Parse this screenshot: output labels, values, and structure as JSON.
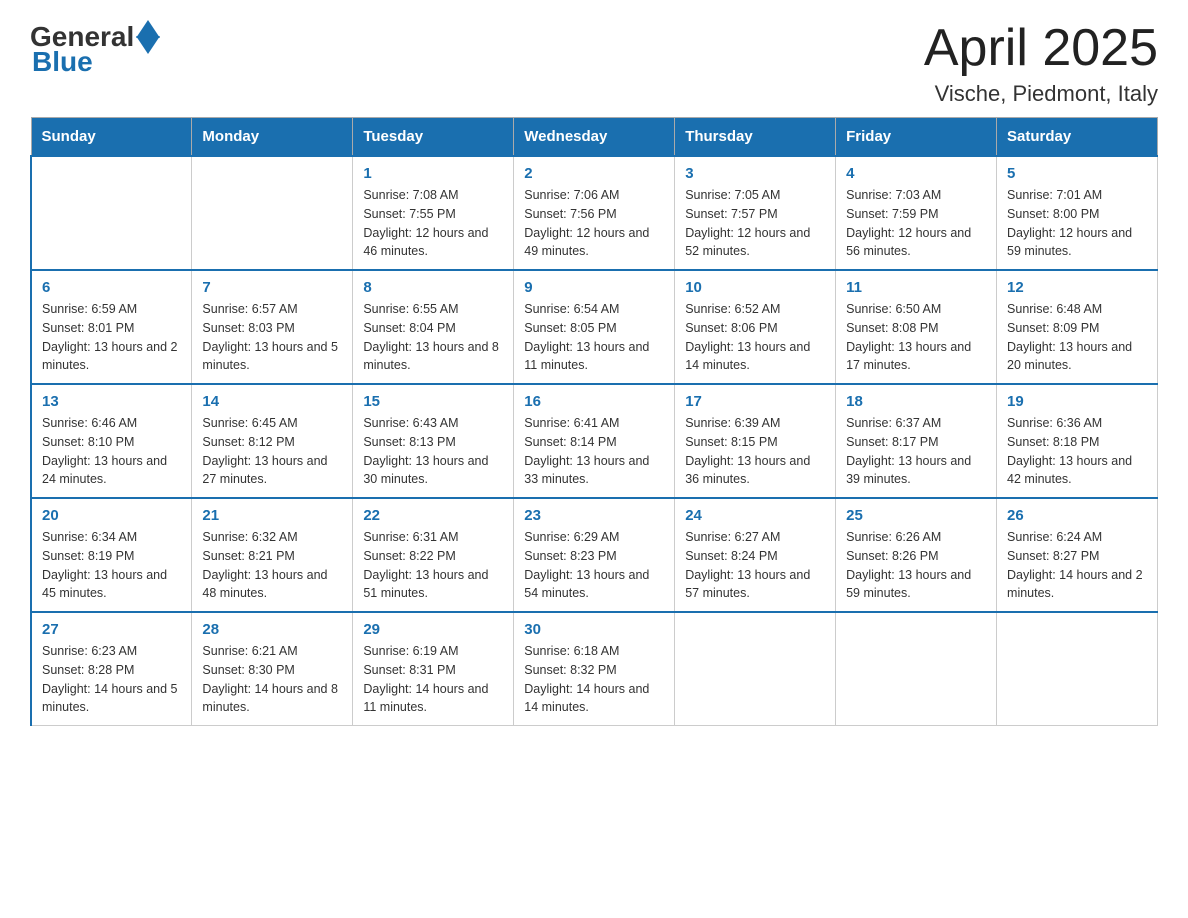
{
  "header": {
    "logo_general": "General",
    "logo_blue": "Blue",
    "month_title": "April 2025",
    "location": "Vische, Piedmont, Italy"
  },
  "days_of_week": [
    "Sunday",
    "Monday",
    "Tuesday",
    "Wednesday",
    "Thursday",
    "Friday",
    "Saturday"
  ],
  "weeks": [
    [
      {
        "day": "",
        "sunrise": "",
        "sunset": "",
        "daylight": ""
      },
      {
        "day": "",
        "sunrise": "",
        "sunset": "",
        "daylight": ""
      },
      {
        "day": "1",
        "sunrise": "Sunrise: 7:08 AM",
        "sunset": "Sunset: 7:55 PM",
        "daylight": "Daylight: 12 hours and 46 minutes."
      },
      {
        "day": "2",
        "sunrise": "Sunrise: 7:06 AM",
        "sunset": "Sunset: 7:56 PM",
        "daylight": "Daylight: 12 hours and 49 minutes."
      },
      {
        "day": "3",
        "sunrise": "Sunrise: 7:05 AM",
        "sunset": "Sunset: 7:57 PM",
        "daylight": "Daylight: 12 hours and 52 minutes."
      },
      {
        "day": "4",
        "sunrise": "Sunrise: 7:03 AM",
        "sunset": "Sunset: 7:59 PM",
        "daylight": "Daylight: 12 hours and 56 minutes."
      },
      {
        "day": "5",
        "sunrise": "Sunrise: 7:01 AM",
        "sunset": "Sunset: 8:00 PM",
        "daylight": "Daylight: 12 hours and 59 minutes."
      }
    ],
    [
      {
        "day": "6",
        "sunrise": "Sunrise: 6:59 AM",
        "sunset": "Sunset: 8:01 PM",
        "daylight": "Daylight: 13 hours and 2 minutes."
      },
      {
        "day": "7",
        "sunrise": "Sunrise: 6:57 AM",
        "sunset": "Sunset: 8:03 PM",
        "daylight": "Daylight: 13 hours and 5 minutes."
      },
      {
        "day": "8",
        "sunrise": "Sunrise: 6:55 AM",
        "sunset": "Sunset: 8:04 PM",
        "daylight": "Daylight: 13 hours and 8 minutes."
      },
      {
        "day": "9",
        "sunrise": "Sunrise: 6:54 AM",
        "sunset": "Sunset: 8:05 PM",
        "daylight": "Daylight: 13 hours and 11 minutes."
      },
      {
        "day": "10",
        "sunrise": "Sunrise: 6:52 AM",
        "sunset": "Sunset: 8:06 PM",
        "daylight": "Daylight: 13 hours and 14 minutes."
      },
      {
        "day": "11",
        "sunrise": "Sunrise: 6:50 AM",
        "sunset": "Sunset: 8:08 PM",
        "daylight": "Daylight: 13 hours and 17 minutes."
      },
      {
        "day": "12",
        "sunrise": "Sunrise: 6:48 AM",
        "sunset": "Sunset: 8:09 PM",
        "daylight": "Daylight: 13 hours and 20 minutes."
      }
    ],
    [
      {
        "day": "13",
        "sunrise": "Sunrise: 6:46 AM",
        "sunset": "Sunset: 8:10 PM",
        "daylight": "Daylight: 13 hours and 24 minutes."
      },
      {
        "day": "14",
        "sunrise": "Sunrise: 6:45 AM",
        "sunset": "Sunset: 8:12 PM",
        "daylight": "Daylight: 13 hours and 27 minutes."
      },
      {
        "day": "15",
        "sunrise": "Sunrise: 6:43 AM",
        "sunset": "Sunset: 8:13 PM",
        "daylight": "Daylight: 13 hours and 30 minutes."
      },
      {
        "day": "16",
        "sunrise": "Sunrise: 6:41 AM",
        "sunset": "Sunset: 8:14 PM",
        "daylight": "Daylight: 13 hours and 33 minutes."
      },
      {
        "day": "17",
        "sunrise": "Sunrise: 6:39 AM",
        "sunset": "Sunset: 8:15 PM",
        "daylight": "Daylight: 13 hours and 36 minutes."
      },
      {
        "day": "18",
        "sunrise": "Sunrise: 6:37 AM",
        "sunset": "Sunset: 8:17 PM",
        "daylight": "Daylight: 13 hours and 39 minutes."
      },
      {
        "day": "19",
        "sunrise": "Sunrise: 6:36 AM",
        "sunset": "Sunset: 8:18 PM",
        "daylight": "Daylight: 13 hours and 42 minutes."
      }
    ],
    [
      {
        "day": "20",
        "sunrise": "Sunrise: 6:34 AM",
        "sunset": "Sunset: 8:19 PM",
        "daylight": "Daylight: 13 hours and 45 minutes."
      },
      {
        "day": "21",
        "sunrise": "Sunrise: 6:32 AM",
        "sunset": "Sunset: 8:21 PM",
        "daylight": "Daylight: 13 hours and 48 minutes."
      },
      {
        "day": "22",
        "sunrise": "Sunrise: 6:31 AM",
        "sunset": "Sunset: 8:22 PM",
        "daylight": "Daylight: 13 hours and 51 minutes."
      },
      {
        "day": "23",
        "sunrise": "Sunrise: 6:29 AM",
        "sunset": "Sunset: 8:23 PM",
        "daylight": "Daylight: 13 hours and 54 minutes."
      },
      {
        "day": "24",
        "sunrise": "Sunrise: 6:27 AM",
        "sunset": "Sunset: 8:24 PM",
        "daylight": "Daylight: 13 hours and 57 minutes."
      },
      {
        "day": "25",
        "sunrise": "Sunrise: 6:26 AM",
        "sunset": "Sunset: 8:26 PM",
        "daylight": "Daylight: 13 hours and 59 minutes."
      },
      {
        "day": "26",
        "sunrise": "Sunrise: 6:24 AM",
        "sunset": "Sunset: 8:27 PM",
        "daylight": "Daylight: 14 hours and 2 minutes."
      }
    ],
    [
      {
        "day": "27",
        "sunrise": "Sunrise: 6:23 AM",
        "sunset": "Sunset: 8:28 PM",
        "daylight": "Daylight: 14 hours and 5 minutes."
      },
      {
        "day": "28",
        "sunrise": "Sunrise: 6:21 AM",
        "sunset": "Sunset: 8:30 PM",
        "daylight": "Daylight: 14 hours and 8 minutes."
      },
      {
        "day": "29",
        "sunrise": "Sunrise: 6:19 AM",
        "sunset": "Sunset: 8:31 PM",
        "daylight": "Daylight: 14 hours and 11 minutes."
      },
      {
        "day": "30",
        "sunrise": "Sunrise: 6:18 AM",
        "sunset": "Sunset: 8:32 PM",
        "daylight": "Daylight: 14 hours and 14 minutes."
      },
      {
        "day": "",
        "sunrise": "",
        "sunset": "",
        "daylight": ""
      },
      {
        "day": "",
        "sunrise": "",
        "sunset": "",
        "daylight": ""
      },
      {
        "day": "",
        "sunrise": "",
        "sunset": "",
        "daylight": ""
      }
    ]
  ]
}
